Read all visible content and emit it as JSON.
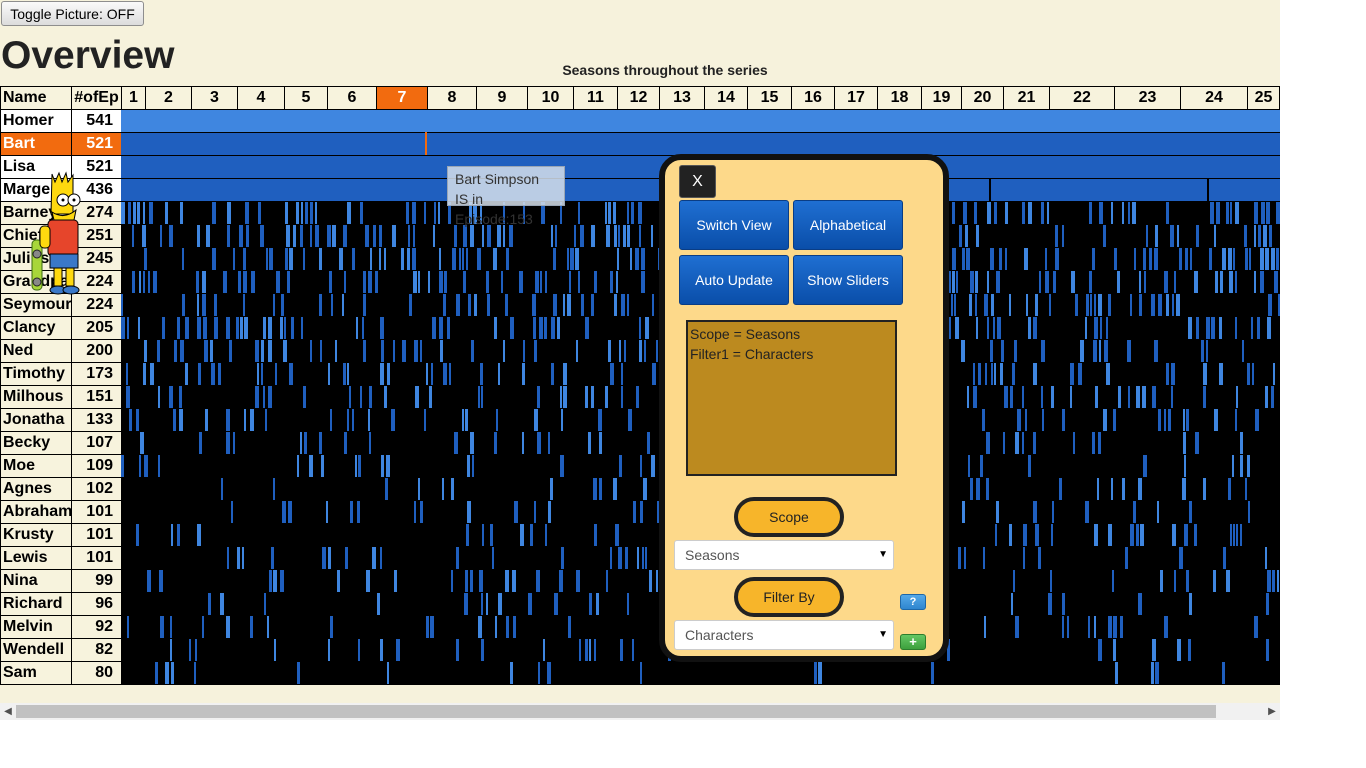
{
  "toggle_button": "Toggle Picture: OFF",
  "page_title": "Overview",
  "chart_title": "Seasons throughout the series",
  "table": {
    "header_name": "Name",
    "header_count": "#ofEp",
    "seasons": [
      "1",
      "2",
      "3",
      "4",
      "5",
      "6",
      "7",
      "8",
      "9",
      "10",
      "11",
      "12",
      "13",
      "14",
      "15",
      "16",
      "17",
      "18",
      "19",
      "20",
      "21",
      "22",
      "23",
      "24",
      "25"
    ],
    "selected_season": "7",
    "rows": [
      {
        "name": "Homer",
        "count": "541"
      },
      {
        "name": "Bart",
        "count": "521"
      },
      {
        "name": "Lisa",
        "count": "521"
      },
      {
        "name": "Marge",
        "count": "436"
      },
      {
        "name": "Barney",
        "count": "274"
      },
      {
        "name": "Chief",
        "count": "251"
      },
      {
        "name": "Julius",
        "count": "245"
      },
      {
        "name": "Grandpa",
        "count": "224"
      },
      {
        "name": "Seymour",
        "count": "224"
      },
      {
        "name": "Clancy",
        "count": "205"
      },
      {
        "name": "Ned",
        "count": "200"
      },
      {
        "name": "Timothy",
        "count": "173"
      },
      {
        "name": "Milhous",
        "count": "151"
      },
      {
        "name": "Jonatha",
        "count": "133"
      },
      {
        "name": "Becky",
        "count": "107"
      },
      {
        "name": "Moe",
        "count": "109"
      },
      {
        "name": "Agnes",
        "count": "102"
      },
      {
        "name": "Abraham",
        "count": "101"
      },
      {
        "name": "Krusty",
        "count": "101"
      },
      {
        "name": "Lewis",
        "count": "101"
      },
      {
        "name": "Nina",
        "count": "99"
      },
      {
        "name": "Richard",
        "count": "96"
      },
      {
        "name": "Melvin",
        "count": "92"
      },
      {
        "name": "Wendell",
        "count": "82"
      },
      {
        "name": "Sam",
        "count": "80"
      }
    ],
    "selected_row": "Bart"
  },
  "tooltip": {
    "line1": "Bart Simpson",
    "line2": "IS in Episode:153"
  },
  "panel": {
    "close": "X",
    "switch_view": "Switch View",
    "alphabetical": "Alphabetical",
    "auto_update": "Auto Update",
    "show_sliders": "Show Sliders",
    "info_line1": "Scope = Seasons",
    "info_line2": "Filter1 = Characters",
    "scope_label": "Scope",
    "scope_value": "Seasons",
    "filter_label": "Filter By",
    "filter_value": "Characters",
    "help": "?",
    "add": "+"
  },
  "colors": {
    "background": "#f6f2dc",
    "selected": "#f26b0f",
    "present": "#1f5fbf",
    "present_light": "#3f86e0",
    "absent": "#000000",
    "panel": "#fdd98a"
  },
  "icons": {
    "mascot": "bart-simpson-figure",
    "scroll_left": "arrow-left-icon",
    "scroll_right": "arrow-right-icon",
    "select_arrow": "caret-down-icon"
  }
}
